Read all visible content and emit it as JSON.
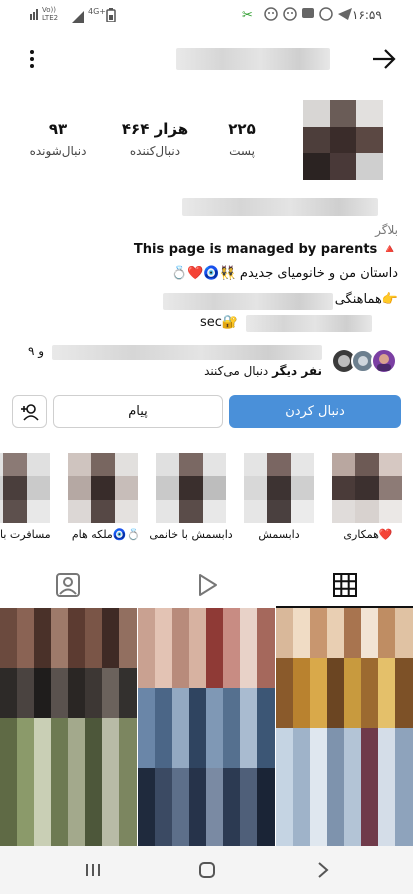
{
  "status_bar": {
    "time": "۱۶:۵۹",
    "network": "4G+",
    "volte": "Vo))",
    "lte": "LTE2"
  },
  "profile": {
    "posts_count": "۲۲۵",
    "posts_label": "پست",
    "followers_count": "۴۶۴ هزار",
    "followers_label": "دنبال‌کننده",
    "following_count": "۹۳",
    "following_label": "دنبال‌شونده",
    "category": "بلاگر",
    "bio_line1": "This page is managed by parents 🔺",
    "bio_line2": "داستان من و خانومیای جدیدم 👯🧿❤️💍",
    "bio_line3": "👉هماهنگی",
    "bio_line4": "sec🔐",
    "followed_by_suffix": "و ۹",
    "followed_by_line2_bold": "نفر دیگر",
    "followed_by_line2_rest": " دنبال می‌کنند"
  },
  "actions": {
    "follow_label": "دنبال کردن",
    "message_label": "پیام"
  },
  "highlights": [
    {
      "label": "همکاری❤️"
    },
    {
      "label": "دابسمش"
    },
    {
      "label": "دابسمش با خانمی"
    },
    {
      "label": "ملکه هام🧿💍"
    },
    {
      "label": "مسافرت با"
    }
  ],
  "tabs": {
    "grid": "grid-icon",
    "reels": "reels-icon",
    "tagged": "tagged-icon"
  }
}
